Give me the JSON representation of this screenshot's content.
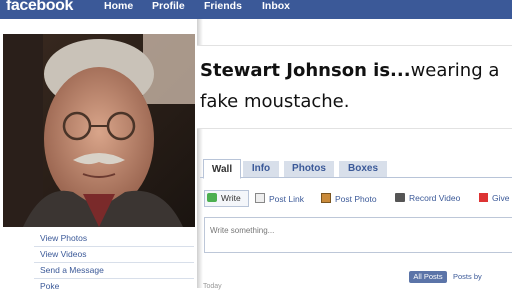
{
  "header": {
    "logo": "facebook",
    "nav": [
      "Home",
      "Profile",
      "Friends",
      "Inbox"
    ]
  },
  "profile": {
    "name_bold": "Stewart Johnson is...",
    "status": "wearing a fake moustache."
  },
  "left_links": [
    "View Photos",
    "View Videos",
    "Send a Message",
    "Poke"
  ],
  "tabs": [
    "Wall",
    "Info",
    "Photos",
    "Boxes"
  ],
  "actions": [
    "Write",
    "Post Link",
    "Post Photo",
    "Record Video",
    "Give"
  ],
  "composer": {
    "placeholder": "Write something..."
  },
  "filter": {
    "all_posts": "All Posts",
    "posts_by": "Posts by"
  },
  "feed": {
    "date_label": "Today"
  },
  "colors": {
    "brand": "#3b5998",
    "tab_bg": "#d8dfea"
  }
}
